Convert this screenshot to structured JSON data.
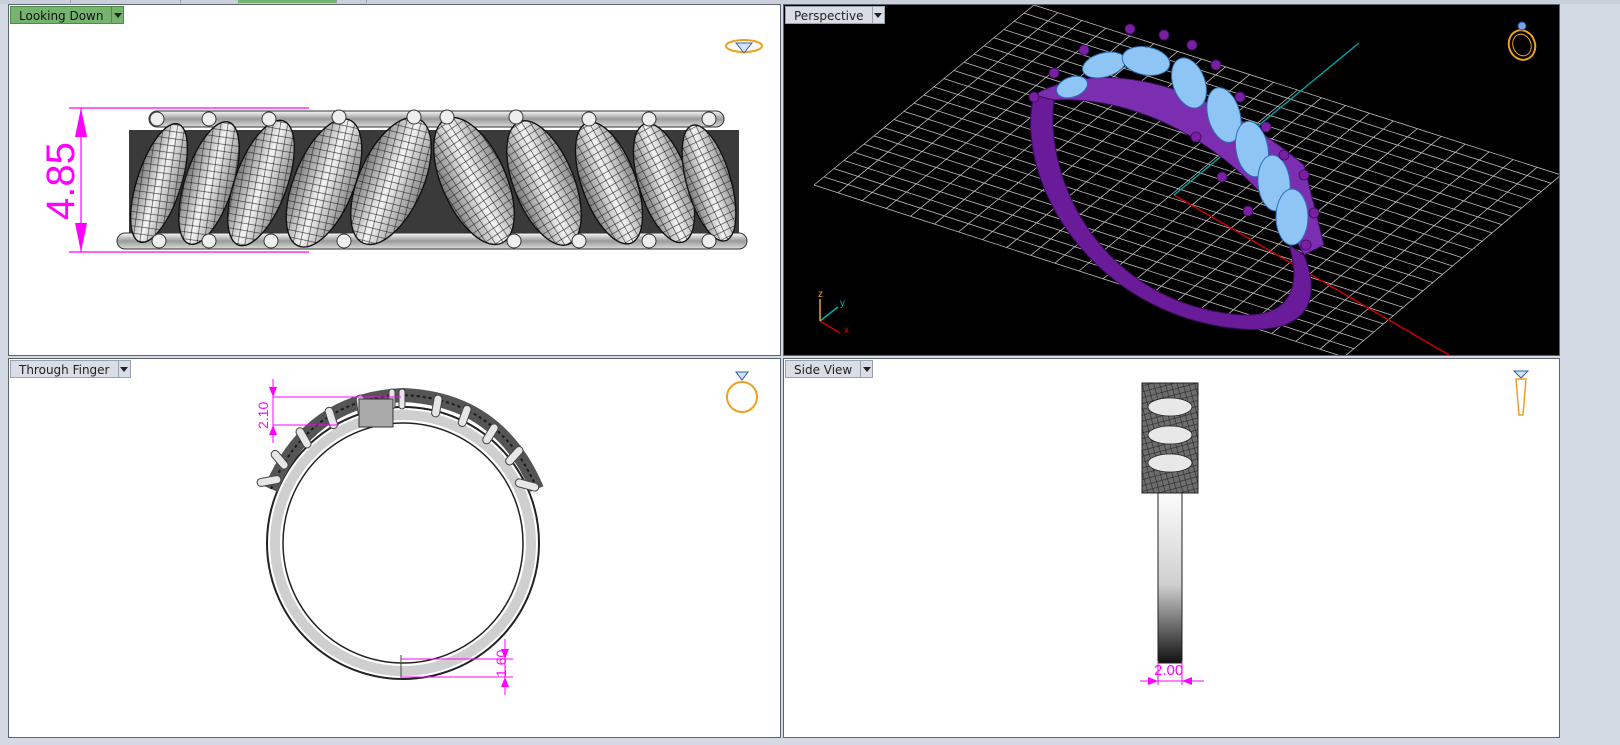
{
  "app": {
    "topbar_tabs": [
      "",
      "",
      "",
      "",
      ""
    ]
  },
  "viewports": {
    "top_left": {
      "label": "Looking Down",
      "active": true,
      "dimension": "4.85"
    },
    "top_right": {
      "label": "Perspective",
      "active": false,
      "axes": {
        "z": "z",
        "y": "y",
        "x": "x"
      }
    },
    "bottom_left": {
      "label": "Through Finger",
      "active": false,
      "dimensions": {
        "top": "2.10",
        "bottom": "1.60"
      }
    },
    "bottom_right": {
      "label": "Side View",
      "active": false,
      "dimension": "2.00"
    }
  },
  "colors": {
    "active_label": "#76b36f",
    "dimension": "#ff00ff",
    "ring_band_perspective": "#6a1b9a",
    "gem_perspective": "#8ec5f5",
    "grid": "#cfcfcf",
    "x_axis": "#c00000",
    "y_axis": "#00a0a0",
    "icon_gold": "#f0a020"
  },
  "icons": {
    "top_left_corner": "ring-top-icon",
    "top_right_corner": "ring-perspective-icon",
    "bottom_left_corner": "ring-front-icon",
    "bottom_right_corner": "ring-side-icon"
  }
}
